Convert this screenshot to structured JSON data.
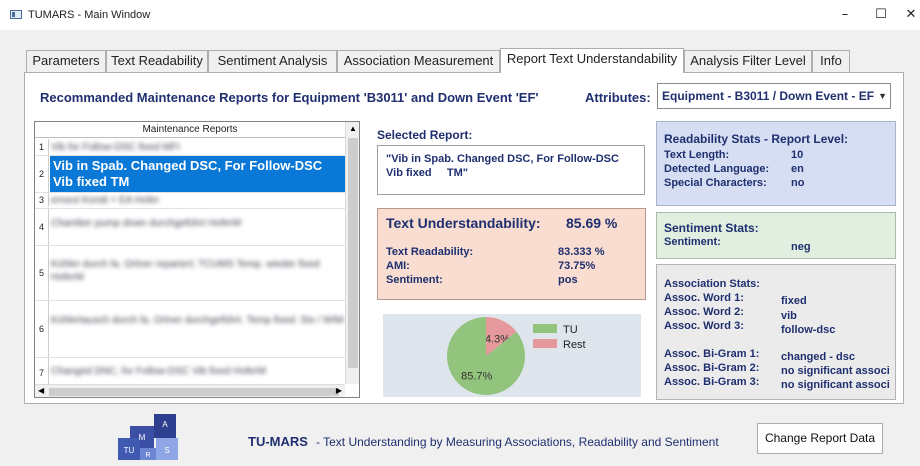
{
  "window": {
    "title": "TUMARS - Main Window",
    "minimize": "–",
    "maximize": "☐",
    "close": "✕"
  },
  "tabs": [
    {
      "label": "Parameters"
    },
    {
      "label": "Text Readability"
    },
    {
      "label": "Sentiment Analysis"
    },
    {
      "label": "Association Measurement"
    },
    {
      "label": "Report Text Understandability",
      "active": true
    },
    {
      "label": "Analysis Filter Level"
    },
    {
      "label": "Info"
    }
  ],
  "heading": "Recommanded Maintenance Reports for Equipment 'B3011' and Down Event 'EF'",
  "attributes": {
    "label": "Attributes:",
    "value": "Equipment - B3011 / Down Event - EF"
  },
  "reports_list": {
    "header": "Maintenance Reports",
    "rows": [
      {
        "num": "1",
        "text": "Vib for Follow-DSC fixed MFI"
      },
      {
        "num": "2",
        "text": "Vib in Spab. Changed DSC, For Follow-DSC Vib fixed TM",
        "selected": true
      },
      {
        "num": "3",
        "text": "erneut Kondi + EA Hofer"
      },
      {
        "num": "4",
        "text": "Chamber pump down durchgeführt HoferM"
      },
      {
        "num": "5",
        "text": "Kühler durch fa. Ortner repariert; TCUMS Temp. wieder fixed HoferM"
      },
      {
        "num": "6",
        "text": "Kühlertausch durch fa. Ortner durchgeführt. Temp fixed. Sts / WIM"
      },
      {
        "num": "7",
        "text": "Changed DNC, for Follow-DSC Vib fixed HoferM"
      }
    ]
  },
  "selected_report": {
    "label": "Selected Report:",
    "text": "\"Vib in Spab. Changed DSC, For Follow-DSC Vib fixed     TM\""
  },
  "understandability": {
    "title": "Text Understandability:",
    "value": "85.69 %",
    "rows": [
      {
        "label": "Text Readability:",
        "value": "83.333 %"
      },
      {
        "label": "AMI:",
        "value": "73.75%"
      },
      {
        "label": "Sentiment:",
        "value": "pos"
      }
    ]
  },
  "chart_data": {
    "type": "pie",
    "labels": [
      "TU",
      "Rest"
    ],
    "values": [
      85.7,
      14.3
    ],
    "value_labels": [
      "85.7%",
      "14.3%"
    ],
    "colors": [
      "#93c47d",
      "#e6999c"
    ],
    "legend": "right"
  },
  "readability_stats": {
    "title": "Readability Stats - Report Level:",
    "rows": [
      {
        "label": "Text Length:",
        "value": "10"
      },
      {
        "label": "Detected Language:",
        "value": "en"
      },
      {
        "label": "Special Characters:",
        "value": "no"
      }
    ]
  },
  "sentiment_stats": {
    "title": "Sentiment Stats:",
    "label": "Sentiment:",
    "value": "neg"
  },
  "association_stats": {
    "title": "Association Stats:",
    "words": [
      {
        "label": "Assoc. Word 1:",
        "value": "fixed"
      },
      {
        "label": "Assoc. Word 2:",
        "value": "vib"
      },
      {
        "label": "Assoc. Word 3:",
        "value": "follow-dsc"
      }
    ],
    "bigrams": [
      {
        "label": "Assoc. Bi-Gram 1:",
        "value": "changed - dsc"
      },
      {
        "label": "Assoc. Bi-Gram 2:",
        "value": "no significant associ"
      },
      {
        "label": "Assoc. Bi-Gram 3:",
        "value": "no significant associ"
      }
    ]
  },
  "footer": {
    "logo_letters": [
      "M",
      "A",
      "TU",
      "R",
      "S"
    ],
    "brand": "TU-MARS",
    "description": "- Text Understanding by Measuring Associations, Readability and Sentiment",
    "change_button": "Change Report Data"
  },
  "colors": {
    "heading_blue": "#1f2f6f",
    "selection_blue": "#0a78d7",
    "understandability_bg": "#f8ddd0",
    "readability_bg": "#d5def2",
    "sentiment_bg": "#e0efe0",
    "association_bg": "#ebebeb"
  }
}
